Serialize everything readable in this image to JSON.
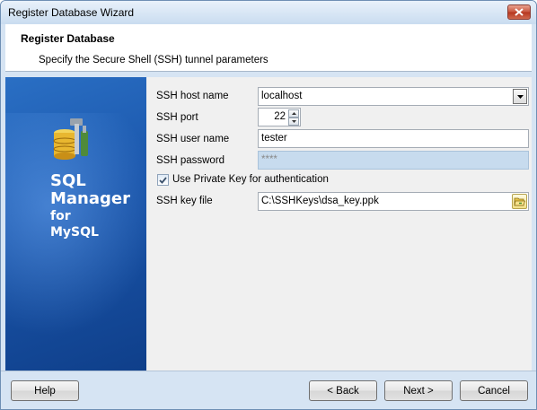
{
  "window": {
    "title": "Register Database Wizard"
  },
  "header": {
    "title": "Register Database",
    "subtitle": "Specify the Secure Shell (SSH) tunnel  parameters"
  },
  "sidepanel": {
    "line1": "SQL",
    "line2": "Manager",
    "line3": "for",
    "line4": "MySQL"
  },
  "form": {
    "host_label": "SSH host name",
    "host_value": "localhost",
    "port_label": "SSH port",
    "port_value": "22",
    "user_label": "SSH user name",
    "user_value": "tester",
    "password_label": "SSH password",
    "password_value": "****",
    "private_key_checkbox_label": "Use Private Key for authentication",
    "private_key_checked": true,
    "key_file_label": "SSH key file",
    "key_file_value": "C:\\SSHKeys\\dsa_key.ppk"
  },
  "buttons": {
    "help": "Help",
    "back": "< Back",
    "next": "Next >",
    "cancel": "Cancel"
  },
  "icons": {
    "close": "close-icon",
    "dropdown": "chevron-down-icon",
    "spin_up": "spin-up-icon",
    "spin_down": "spin-down-icon",
    "check": "check-icon",
    "browse": "open-folder-icon",
    "product_logo": "database-tools-icon"
  }
}
